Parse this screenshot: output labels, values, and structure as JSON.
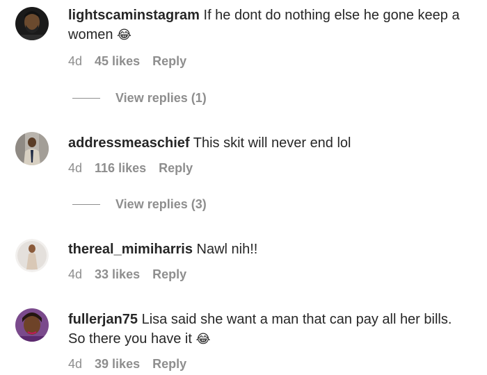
{
  "comments": [
    {
      "username": "lightscaminstagram",
      "text": "If he dont do nothing else he gone keep a women",
      "emoji": "😂",
      "time": "4d",
      "likes": "45 likes",
      "reply": "Reply",
      "view_replies": "View replies (1)"
    },
    {
      "username": "addressmeaschief",
      "text": "This skit will never end lol",
      "emoji": "",
      "time": "4d",
      "likes": "116 likes",
      "reply": "Reply",
      "view_replies": "View replies (3)"
    },
    {
      "username": "thereal_mimiharris",
      "text": "Nawl nih!!",
      "emoji": "",
      "time": "4d",
      "likes": "33 likes",
      "reply": "Reply"
    },
    {
      "username": "fullerjan75",
      "text": "Lisa said she want a man that can pay all her bills. So there you have it",
      "emoji": "😂",
      "time": "4d",
      "likes": "39 likes",
      "reply": "Reply"
    }
  ]
}
